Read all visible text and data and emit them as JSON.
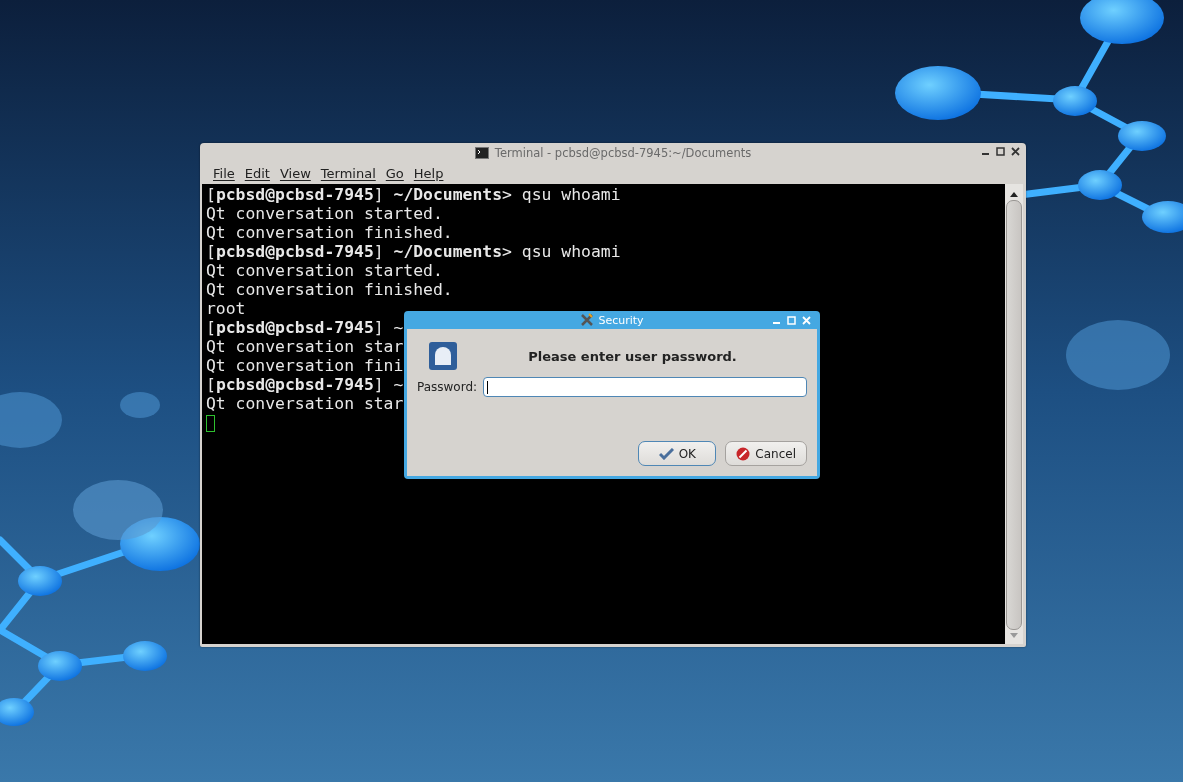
{
  "terminal_window": {
    "title": "Terminal - pcbsd@pcbsd-7945:~/Documents",
    "menu": [
      {
        "label": "File"
      },
      {
        "label": "Edit"
      },
      {
        "label": "View"
      },
      {
        "label": "Terminal"
      },
      {
        "label": "Go"
      },
      {
        "label": "Help"
      }
    ],
    "lines": [
      "[**pcbsd@pcbsd-7945**] **~/Documents**> qsu whoami",
      "Qt conversation started.",
      "Qt conversation finished.",
      "[**pcbsd@pcbsd-7945**] **~/Documents**> qsu whoami",
      "Qt conversation started.",
      "Qt conversation finished.",
      "root",
      "[**pcbsd@pcbsd-7945**] ~",
      "Qt conversation star",
      "Qt conversation fini",
      "[**pcbsd@pcbsd-7945**] ~",
      "Qt conversation star"
    ]
  },
  "dialog": {
    "title": "Security",
    "message": "Please enter user password.",
    "field_label": "Password:",
    "buttons": [
      {
        "label": "OK",
        "kind": "ok"
      },
      {
        "label": "Cancel",
        "kind": "cancel"
      }
    ]
  }
}
